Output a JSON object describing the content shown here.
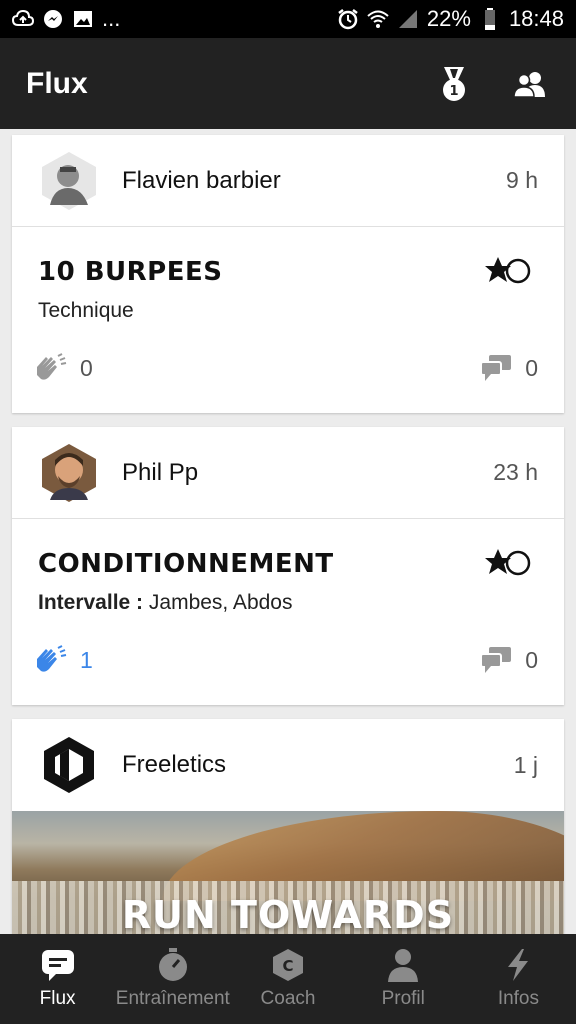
{
  "status_bar": {
    "left_icons": [
      "upload-cloud-icon",
      "messenger-icon",
      "image-icon"
    ],
    "more": "...",
    "battery": "22%",
    "time": "18:48"
  },
  "app_bar": {
    "title": "Flux",
    "icons": [
      "medal-icon",
      "friends-icon"
    ]
  },
  "feed": [
    {
      "author": "Flavien barbier",
      "time": "9 h",
      "title": "10 BURPEES",
      "subtitle_label": "",
      "subtitle": "Technique",
      "claps": "0",
      "claps_active": false,
      "comments": "0"
    },
    {
      "author": "Phil Pp",
      "time": "23 h",
      "title": "CONDITIONNEMENT",
      "subtitle_label": "Intervalle :",
      "subtitle": "Jambes, Abdos",
      "claps": "1",
      "claps_active": true,
      "comments": "0"
    },
    {
      "author": "Freeletics",
      "time": "1 j",
      "promo_text": "RUN TOWARDS"
    }
  ],
  "bottom_nav": [
    {
      "label": "Flux",
      "icon": "chat-bubble-icon",
      "active": true
    },
    {
      "label": "Entraînement",
      "icon": "stopwatch-icon",
      "active": false
    },
    {
      "label": "Coach",
      "icon": "coach-hexagon-icon",
      "active": false
    },
    {
      "label": "Profil",
      "icon": "person-icon",
      "active": false
    },
    {
      "label": "Infos",
      "icon": "lightning-icon",
      "active": false
    }
  ],
  "colors": {
    "appbar": "#222222",
    "accent": "#3b86e8",
    "background": "#ececec"
  }
}
